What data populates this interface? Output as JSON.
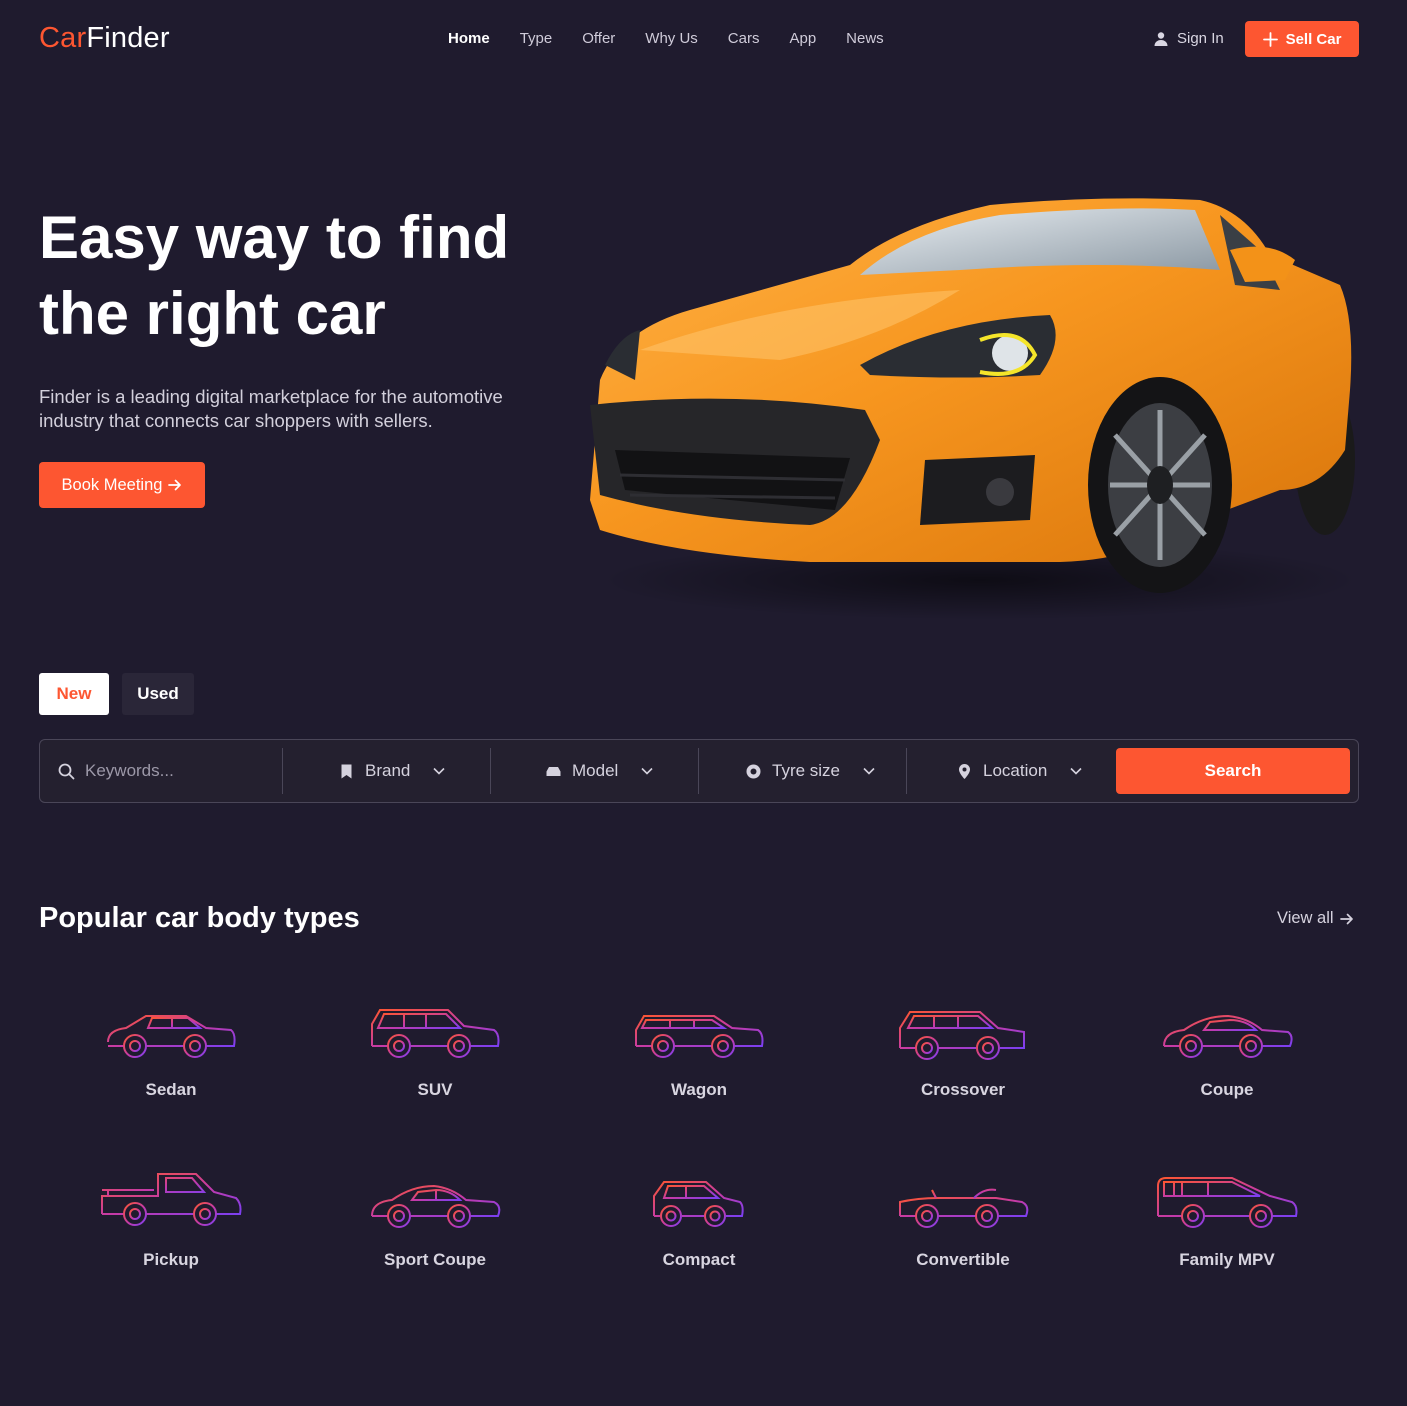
{
  "brand": {
    "logo_part1": "Car",
    "logo_part2": "Finder",
    "accent_color": "#fd5631"
  },
  "nav": {
    "links": [
      "Home",
      "Type",
      "Offer",
      "Why Us",
      "Cars",
      "App",
      "News"
    ],
    "active": "Home",
    "signin_label": "Sign In",
    "sell_label": "Sell Car"
  },
  "hero": {
    "title_line1": "Easy way to find",
    "title_line2": "the right car",
    "description": "Finder is a leading digital marketplace for the automotive industry that connects car shoppers with sellers.",
    "cta_label": "Book Meeting"
  },
  "tabs": {
    "new_label": "New",
    "used_label": "Used",
    "active": "New"
  },
  "search": {
    "keywords_placeholder": "Keywords...",
    "brand_label": "Brand",
    "model_label": "Model",
    "tyre_label": "Tyre size",
    "location_label": "Location",
    "search_label": "Search"
  },
  "body_types": {
    "title": "Popular car body types",
    "view_all": "View all",
    "items": [
      "Sedan",
      "SUV",
      "Wagon",
      "Crossover",
      "Coupe",
      "Pickup",
      "Sport Coupe",
      "Compact",
      "Convertible",
      "Family MPV"
    ]
  }
}
